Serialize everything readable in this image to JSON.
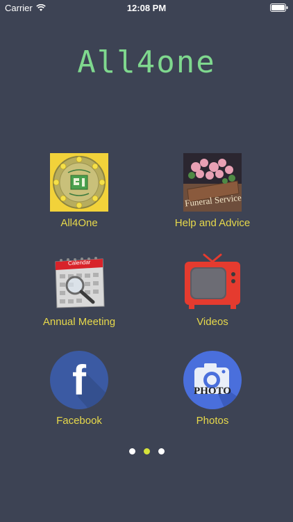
{
  "status_bar": {
    "carrier": "Carrier",
    "time": "12:08 PM"
  },
  "app": {
    "title": "All4one"
  },
  "tiles": [
    {
      "label": "All4One",
      "icon": "emblem-icon"
    },
    {
      "label": "Help and Advice",
      "icon": "funeral-services-icon",
      "icon_caption": "Funeral Services"
    },
    {
      "label": "Annual Meeting",
      "icon": "calendar-icon",
      "icon_caption": "Calendar"
    },
    {
      "label": "Videos",
      "icon": "tv-icon"
    },
    {
      "label": "Facebook",
      "icon": "facebook-icon",
      "icon_caption": "f"
    },
    {
      "label": "Photos",
      "icon": "camera-icon",
      "icon_caption": "PHOTO"
    }
  ],
  "pager": {
    "pages": 3,
    "current_page": 2
  },
  "colors": {
    "background": "#3d4354",
    "title": "#7fd88e",
    "label": "#e7d94b",
    "dot_active": "#d6e33a",
    "dot_inactive": "#ffffff"
  }
}
